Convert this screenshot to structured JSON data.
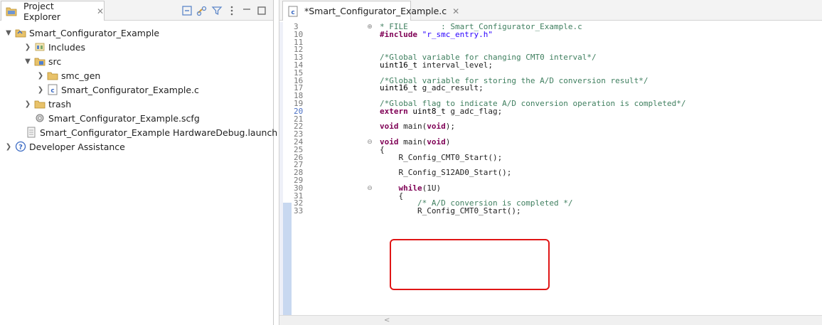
{
  "explorer": {
    "tab_label": "Project Explorer",
    "close_glyph": "✕",
    "toolbar_icons": [
      "collapse-all-icon",
      "link-with-editor-icon",
      "filter-icon",
      "view-menu-icon",
      "minimize-icon",
      "maximize-icon"
    ],
    "tree": [
      {
        "label": "Smart_Configurator_Example",
        "icon": "project-icon",
        "level": 0,
        "expanded": true
      },
      {
        "label": "Includes",
        "icon": "includes-icon",
        "level": 1,
        "expanded": false
      },
      {
        "label": "src",
        "icon": "source-folder-icon",
        "level": 1,
        "expanded": true
      },
      {
        "label": "smc_gen",
        "icon": "folder-icon",
        "level": 2,
        "expanded": false
      },
      {
        "label": "Smart_Configurator_Example.c",
        "icon": "c-file-icon",
        "level": 2,
        "expanded": false
      },
      {
        "label": "trash",
        "icon": "folder-icon",
        "level": 1,
        "expanded": false
      },
      {
        "label": "Smart_Configurator_Example.scfg",
        "icon": "scfg-file-icon",
        "level": 1,
        "expanded": null
      },
      {
        "label": "Smart_Configurator_Example HardwareDebug.launch",
        "icon": "launch-file-icon",
        "level": 1,
        "expanded": null
      },
      {
        "label": "Developer Assistance",
        "icon": "help-icon",
        "level": 0,
        "expanded": false
      }
    ]
  },
  "editor": {
    "tab_label": "*Smart_Configurator_Example.c",
    "close_glyph": "✕",
    "scroll_left_glyph": "<",
    "lines": [
      {
        "n": "3",
        "text": "* FILE       : Smart_Configurator_Example.c",
        "kind": "comment",
        "fold": "plus"
      },
      {
        "n": "10",
        "text": "#include \"r_smc_entry.h\"",
        "kind": "include"
      },
      {
        "n": "11",
        "text": ""
      },
      {
        "n": "12",
        "text": ""
      },
      {
        "n": "13",
        "text": "/*Global variable for changing CMT0 interval*/",
        "kind": "comment"
      },
      {
        "n": "14",
        "text": "uint16_t interval_level;",
        "kind": "decl"
      },
      {
        "n": "15",
        "text": ""
      },
      {
        "n": "16",
        "text": "/*Global variable for storing the A/D conversion result*/",
        "kind": "comment"
      },
      {
        "n": "17",
        "text": "uint16_t g_adc_result;",
        "kind": "decl"
      },
      {
        "n": "18",
        "text": ""
      },
      {
        "n": "19",
        "text": "/*Global flag to indicate A/D conversion operation is completed*/",
        "kind": "comment"
      },
      {
        "n": "20",
        "text": "extern uint8_t g_adc_flag;",
        "kind": "extern"
      },
      {
        "n": "21",
        "text": ""
      },
      {
        "n": "22",
        "text": "void main(void);",
        "kind": "void"
      },
      {
        "n": "23",
        "text": ""
      },
      {
        "n": "24",
        "text": "void main(void)",
        "kind": "void",
        "fold": "minus"
      },
      {
        "n": "25",
        "text": "{"
      },
      {
        "n": "26",
        "text": "    R_Config_CMT0_Start();"
      },
      {
        "n": "27",
        "text": ""
      },
      {
        "n": "28",
        "text": "    R_Config_S12AD0_Start();"
      },
      {
        "n": "29",
        "text": ""
      },
      {
        "n": "30",
        "text": "    while(1U)",
        "kind": "while",
        "fold": "minus"
      },
      {
        "n": "31",
        "text": "    {"
      },
      {
        "n": "32",
        "text": "        /* A/D conversion is completed */",
        "kind": "comment"
      },
      {
        "n": "33",
        "text": "        R_Config_CMT0_Start();"
      }
    ]
  },
  "colors": {
    "keyword": "#7f0055",
    "comment": "#3f7f5f",
    "string": "#2a00ff",
    "highlight_box": "#e01616"
  }
}
